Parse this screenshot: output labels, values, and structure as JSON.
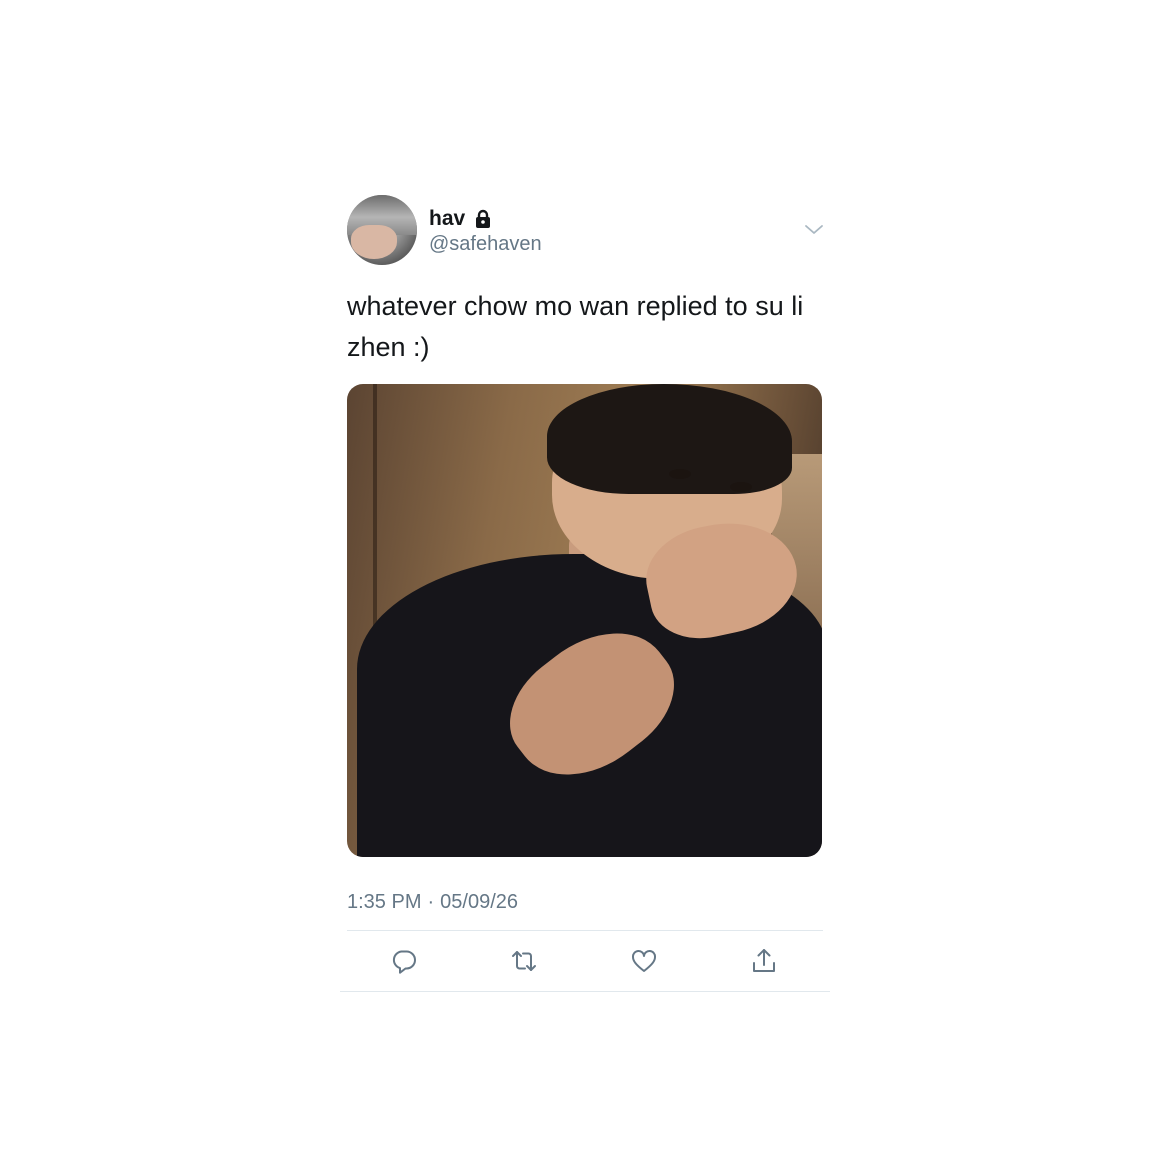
{
  "tweet": {
    "display_name": "hav",
    "handle": "@safehaven",
    "text": "whatever chow mo wan replied to su li zhen :)",
    "time": "1:35 PM",
    "separator": "·",
    "date": "05/09/26",
    "protected_icon": "lock-icon",
    "menu_icon": "chevron-down-icon"
  },
  "actions": [
    {
      "icon": "reply-icon"
    },
    {
      "icon": "retweet-icon"
    },
    {
      "icon": "like-icon"
    },
    {
      "icon": "share-icon"
    }
  ],
  "colors": {
    "text_primary": "#14171a",
    "text_secondary": "#657786",
    "icon_gray": "#657786",
    "divider": "#e1e8ed",
    "background": "#ffffff"
  }
}
